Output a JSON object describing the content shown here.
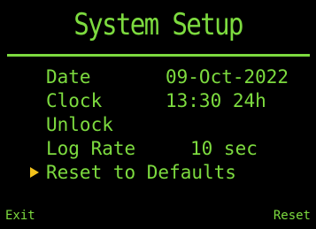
{
  "title": "System Setup",
  "menu": [
    {
      "label": "Date",
      "value": "09-Oct-2022"
    },
    {
      "label": "Clock",
      "value": "13:30 24h"
    },
    {
      "label": "Unlock",
      "value": ""
    },
    {
      "label": "Log Rate",
      "value": "10 sec"
    },
    {
      "label": "Reset to Defaults",
      "value": ""
    }
  ],
  "selected_index": 4,
  "softkeys": {
    "left": "Exit",
    "right": "Reset"
  },
  "colors": {
    "text": "#7ddb3f",
    "cursor": "#f2c21b",
    "background": "#000000"
  }
}
